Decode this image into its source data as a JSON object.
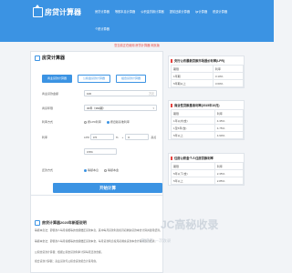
{
  "header": {
    "logo_text": "房贷计算器",
    "nav": [
      "房贷计算器",
      "等额本息计算器",
      "公积金贷款计算器",
      "提前还款计算器",
      "lpr计算器",
      "税费计算器"
    ],
    "nav2": "个税计算器"
  },
  "notice": "您当前正在使用 房贷计算器 网页版",
  "main": {
    "title": "房贷计算器",
    "tabs": [
      "商业贷款计算器",
      "公积金贷款计算器",
      "组合贷款计算器"
    ],
    "rows": [
      {
        "label": "商业贷款金额",
        "value": "100",
        "unit": "万元"
      },
      {
        "label": "商贷年限",
        "value": "30年（360期）"
      },
      {
        "label": "利率方式",
        "opt1": "按LPR利率",
        "opt2": "按旧版基准利率"
      },
      {
        "label": "利率",
        "lpr_label": "LPR",
        "lpr_value": "3.5",
        "unit": "%",
        "plus": "+",
        "bp_value": "0",
        "bp_unit": "基点"
      },
      {
        "label": "",
        "value": "3.5%"
      },
      {
        "label": "还款方式",
        "opt1": "等额本息",
        "opt2": "等额本金"
      }
    ],
    "button": "开始计算"
  },
  "side1": {
    "title": "央行公布最新贷款市场报价利率(LPR)",
    "rows": [
      [
        "期限",
        "利率"
      ],
      [
        "1年期",
        "3.10%"
      ],
      [
        "5年期以上",
        "3.60%"
      ]
    ]
  },
  "side2": {
    "title": "商业性贷款基准利率(2015年10月)",
    "rows": [
      [
        "期限",
        "利率"
      ],
      [
        "1年以内(含)",
        "4.35%"
      ],
      [
        "1至5年(含)",
        "4.75%"
      ],
      [
        "5年以上",
        "4.90%"
      ]
    ]
  },
  "side3": {
    "title": "住房公积金个人住房贷款利率",
    "rows": [
      [
        "期限",
        "利率"
      ],
      [
        "5年以下(含)",
        "2.35%"
      ],
      [
        "5年以上",
        "2.85%"
      ]
    ]
  },
  "sec2": {
    "title": "房贷计算器2020年新版说明",
    "p1": "等额本息法：即借款人每月按相等的金额偿还贷款本息，其中每月贷款利息按月初剩余贷款本金计算并逐月结清。",
    "p2": "等额本金法：即借款人每月按相等的金额偿还贷款本金，每月贷款利息按月初剩余贷款本金计算并逐月结清。",
    "p3": "公积金贷款计算器：根据公积金贷款利率计算每月还款金额。",
    "p4": "组合贷款计算器：商业贷款与公积金贷款组合计算月供。"
  },
  "watermark": {
    "big": "JC高秘收录",
    "small": "一键提交 一次收录"
  }
}
